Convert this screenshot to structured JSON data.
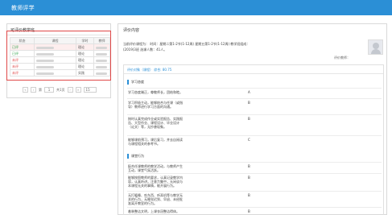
{
  "header": {
    "title": "教师评学"
  },
  "left": {
    "title": "可评价教学班",
    "columns": [
      "状态",
      "课程",
      "学时",
      "教师"
    ],
    "rows": [
      {
        "status": "已评",
        "status_type": "done",
        "hours": "理论"
      },
      {
        "status": "已评",
        "status_type": "done",
        "hours": "理论"
      },
      {
        "status": "未评",
        "status_type": "todo",
        "hours": "理论"
      },
      {
        "status": "未评",
        "status_type": "todo",
        "hours": "理论"
      },
      {
        "status": "未评",
        "status_type": "todo",
        "hours": "实践"
      }
    ],
    "pager": {
      "first": "«",
      "prev": "‹",
      "page_prefix": "第",
      "page": "1",
      "page_suffix": "共1页",
      "next": "›",
      "last": "»",
      "page_size": "15"
    }
  },
  "right": {
    "title": "评价内容",
    "info_line1": "当前评价课程为：              时间：星期二第1-2节(1-12周) 星期五第1-2节(1-12周) 教学班组成：",
    "info_line2": "      (2019)3班 选课人数：41人。",
    "teacher_label": "评价教师：",
    "score_panel": {
      "label": "评价对象（课程） 综合: 80.75"
    },
    "sections": [
      {
        "title": "学习态度",
        "items": [
          {
            "q": "学习态度端正，尊敬师长，团结和睦。",
            "a": "A"
          },
          {
            "q": "学习积极主动，能够结合与任课（或指导）教师进行学习方面的沟通。",
            "a": "B"
          },
          {
            "q": "按时认真完成作业或实验报告、实践报告、大型作业、课程设计、毕业设计（论文）等，无抄袭现象。",
            "a": "B"
          },
          {
            "q": "能够课前预习，课后复习，并去自阅读与课程相关的参考书。",
            "a": "C"
          }
        ]
      },
      {
        "title": "课堂行为",
        "items": [
          {
            "q": "配合任课教师的教学活动，与教师产生互动，课堂气氛活跃。",
            "a": "B"
          },
          {
            "q": "能够按照教师的要求，认真记录教学内容，认真听讲，注意力集中，无闲谈与本课程无关的事情，能开展行为。",
            "a": "B"
          },
          {
            "q": "无打瞌睡、吃东西、听耳机等与教学无关的行为，无睡觉迟到、早退、未经批准离开教室的行为。",
            "a": "B"
          },
          {
            "q": "着装整洁文明，上课衣冠整洁得体。",
            "a": "B"
          }
        ]
      }
    ]
  },
  "colors": {
    "header_bg": "#2b8fd6",
    "accent": "#2b8fd6",
    "done": "#2ea24a",
    "todo": "#e04848"
  }
}
